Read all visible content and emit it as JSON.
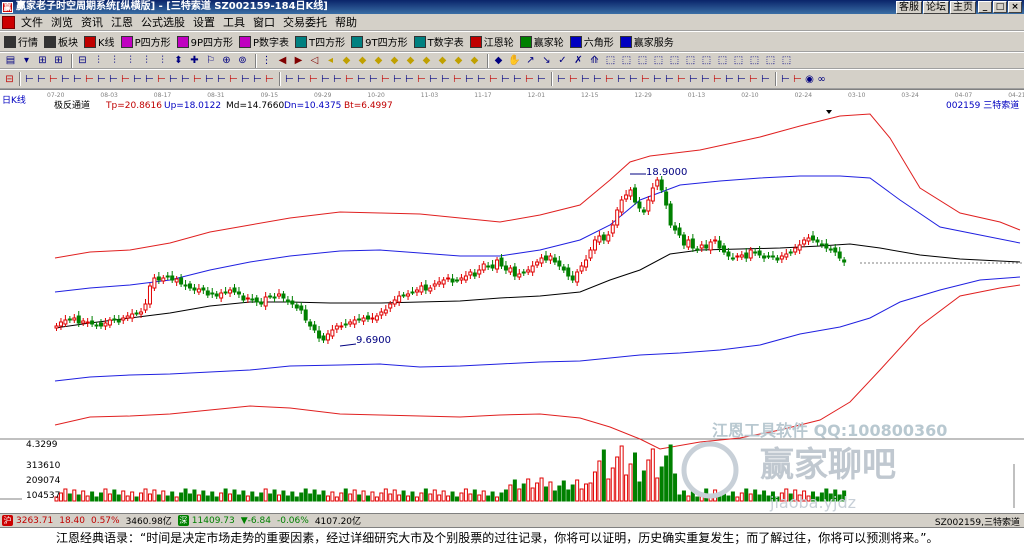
{
  "window": {
    "title": "赢家老子时空周期系统[纵横版] - [三特索道  SZ002159-184日K线]",
    "links": [
      "客服",
      "论坛",
      "主页"
    ],
    "buttons": [
      "_",
      "□",
      "×"
    ]
  },
  "menu": [
    "文件",
    "浏览",
    "资讯",
    "江恩",
    "公式选股",
    "设置",
    "工具",
    "窗口",
    "交易委托",
    "帮助"
  ],
  "toolbar1": [
    {
      "label": "行情",
      "icon": "grid-icon",
      "color": "#333333"
    },
    {
      "label": "板块",
      "icon": "blocks-icon",
      "color": "#333333"
    },
    {
      "label": "K线",
      "icon": "candle-icon",
      "color": "#c00000"
    },
    {
      "label": "P四方形",
      "icon": "p-square-icon",
      "color": "#c000c0"
    },
    {
      "label": "9P四方形",
      "icon": "9p-square-icon",
      "color": "#c000c0"
    },
    {
      "label": "P数字表",
      "icon": "p-table-icon",
      "color": "#c000c0"
    },
    {
      "label": "T四方形",
      "icon": "t-square-icon",
      "color": "#008080"
    },
    {
      "label": "9T四方形",
      "icon": "9t-square-icon",
      "color": "#008080"
    },
    {
      "label": "T数字表",
      "icon": "t-table-icon",
      "color": "#008080"
    },
    {
      "label": "江恩轮",
      "icon": "gann-wheel-icon",
      "color": "#c00000"
    },
    {
      "label": "赢家轮",
      "icon": "winner-wheel-icon",
      "color": "#008000"
    },
    {
      "label": "六角形",
      "icon": "hexagon-icon",
      "color": "#0000c0"
    },
    {
      "label": "赢家服务",
      "icon": "service-icon",
      "color": "#0000c0"
    }
  ],
  "chart": {
    "period_label": "日K线",
    "indicator": {
      "name": "极反通道",
      "tp": "Tp=20.8616",
      "up": "Up=18.0122",
      "md": "Md=14.7660",
      "dn": "Dn=10.4375",
      "bt": "Bt=6.4997"
    },
    "stock_label": "002159  三特索道",
    "dates": [
      "07-20",
      "08-03",
      "08-17",
      "08-31",
      "09-15",
      "09-29",
      "10-20",
      "11-03",
      "11-17",
      "12-01",
      "12-15",
      "12-29",
      "01-13",
      "02-10",
      "02-24",
      "03-10",
      "03-24",
      "04-07",
      "04-21"
    ],
    "high_label": "18.9000",
    "low_label": "9.6900",
    "volume_axis": [
      "4.3299",
      "313610",
      "209074",
      "104537"
    ],
    "watermark1": "江恩工具软件  QQ:100800360",
    "watermark2": "赢家聊吧",
    "watermark3": "jiaoba.yjdz"
  },
  "chart_data": {
    "type": "line",
    "title": "",
    "x_ticks": [
      "07-20",
      "08-03",
      "08-17",
      "08-31",
      "09-15",
      "09-29",
      "10-20",
      "11-03",
      "11-17",
      "12-01",
      "12-15",
      "12-29",
      "01-13",
      "02-10",
      "02-24",
      "03-10",
      "03-24",
      "04-07",
      "04-21"
    ],
    "series": [
      {
        "name": "Tp",
        "last": 20.8616
      },
      {
        "name": "Up",
        "last": 18.0122
      },
      {
        "name": "Md",
        "last": 14.766
      },
      {
        "name": "Dn",
        "last": 10.4375
      },
      {
        "name": "Bt",
        "last": 6.4997
      }
    ],
    "annotations": {
      "high": 18.9,
      "low": 9.69
    },
    "volume_ticks": [
      104537,
      209074,
      313610
    ]
  },
  "status": {
    "index": "3263.71",
    "change": "18.40",
    "pct": "0.57%",
    "amount": "3460.98亿",
    "index2": "11409.73",
    "change2": "▼-6.84",
    "pct2": "-0.06%",
    "amount2": "4107.20亿",
    "right": "SZ002159,三特索道"
  },
  "quote": "江恩经典语录：“时间是决定市场走势的重要因素，经过详细研究大市及个别股票的过往记录，你将可以证明，历史确实重复发生；而了解过往，你将可以预测将来。”。"
}
